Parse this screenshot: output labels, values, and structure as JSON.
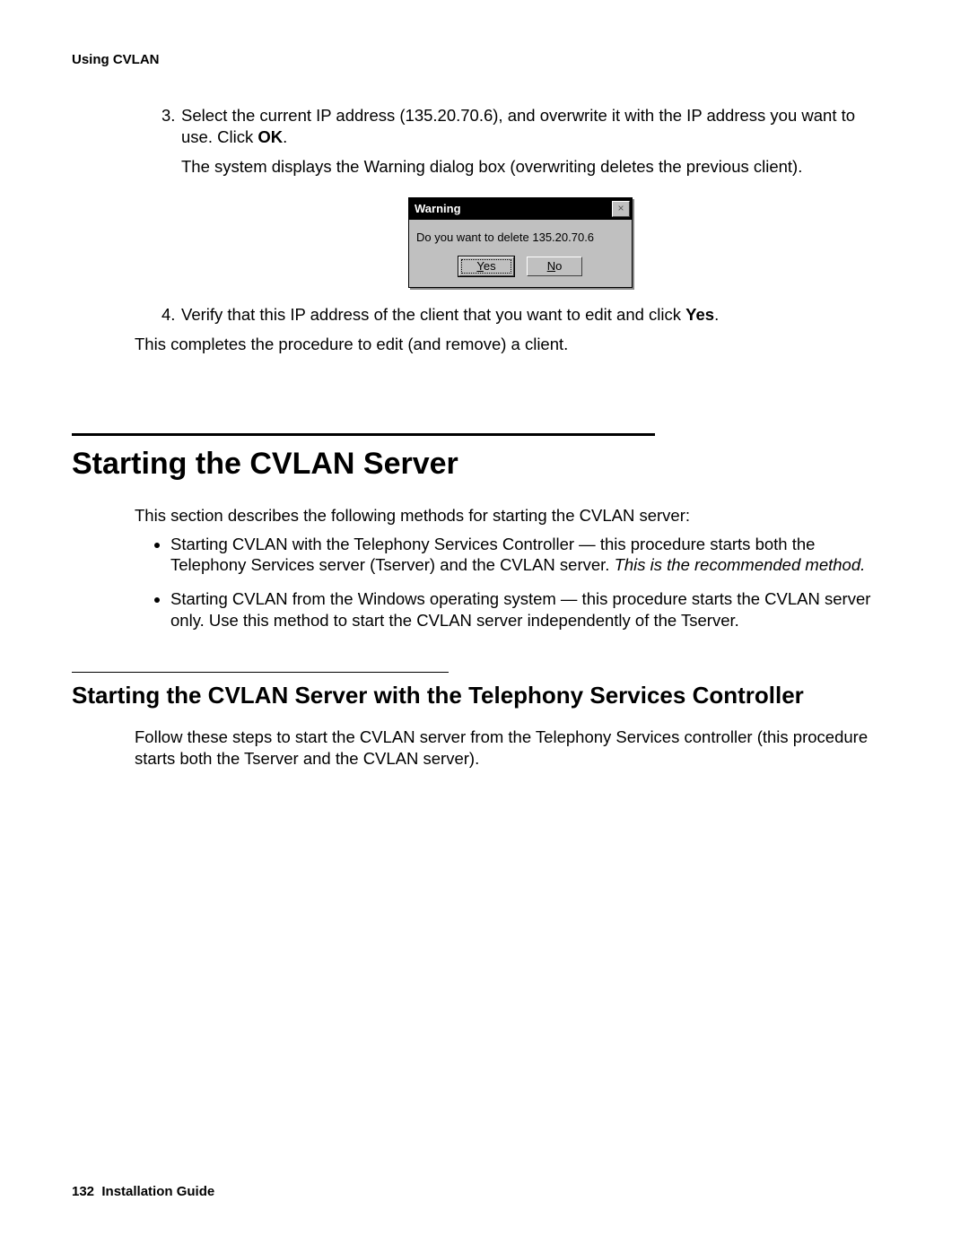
{
  "running_head": "Using CVLAN",
  "step3": {
    "num": "3.",
    "text_a": "Select the current IP address (135.20.70.6), and overwrite it with the IP address you want to use. Click ",
    "ok": "OK",
    "period": ".",
    "sub": "The system displays the Warning dialog box (overwriting deletes the previous client)."
  },
  "dialog": {
    "title": "Warning",
    "close": "×",
    "message": "Do you want to delete 135.20.70.6",
    "yes_u": "Y",
    "yes_rest": "es",
    "no_u": "N",
    "no_rest": "o"
  },
  "step4": {
    "num": "4.",
    "text_a": "Verify that this IP address of the client that you want to edit and click ",
    "yes": "Yes",
    "period": "."
  },
  "completion": "This completes the procedure to edit (and remove) a client.",
  "h1": "Starting the CVLAN Server",
  "intro": "This section describes the following methods for starting the CVLAN server:",
  "bullet1": {
    "a": "Starting CVLAN with the Telephony Services Controller — this procedure starts both the Telephony Services server (Tserver) and the CVLAN server. ",
    "em": "This is the recommended method."
  },
  "bullet2": "Starting CVLAN from the Windows operating system — this procedure starts the CVLAN server only. Use this method to start the CVLAN server independently of the Tserver.",
  "h2": "Starting the CVLAN Server with the Telephony Services Controller",
  "sub_intro": "Follow these steps to start the CVLAN server from the Telephony Services controller (this procedure starts both the Tserver and the CVLAN server).",
  "footer_page": "132",
  "footer_title": "Installation Guide"
}
